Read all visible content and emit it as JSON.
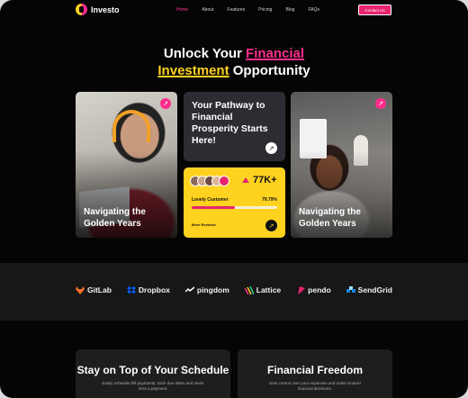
{
  "brand": {
    "name": "Investo"
  },
  "nav": {
    "items": [
      {
        "label": "Home",
        "active": true
      },
      {
        "label": "About"
      },
      {
        "label": "Features"
      },
      {
        "label": "Pricing"
      },
      {
        "label": "Blog"
      },
      {
        "label": "FAQs"
      }
    ],
    "contact_label": "Contact Us"
  },
  "hero": {
    "line1_a": "Unlock Your ",
    "line1_b": "Financial",
    "line2_a": "Investment",
    "line2_b": " Opportunity"
  },
  "cards": {
    "left_caption": "Navigating the Golden Years",
    "pathway_text": "Your Pathway to Financial Prosperity Starts Here!",
    "stat_value": "77K+",
    "customer_label": "Lovely Customer",
    "customer_pct": "79.79%",
    "customer_fraction": 0.5,
    "more_reviews": "More Reviews",
    "right_caption": "Navigating the Golden Years"
  },
  "brands": [
    {
      "name": "GitLab",
      "color": "#fc6d26"
    },
    {
      "name": "Dropbox",
      "color": "#0061ff"
    },
    {
      "name": "pingdom",
      "color": "#ffffff"
    },
    {
      "name": "Lattice",
      "color": "#ffd21f"
    },
    {
      "name": "pendo",
      "color": "#e8246f"
    },
    {
      "name": "SendGrid",
      "color": "#1a82e2"
    }
  ],
  "features": {
    "left_title": "Stay on Top of Your Schedule",
    "left_text": "Easily schedule bill payments, track due dates and never miss a payment.",
    "right_title": "Financial Freedom",
    "right_text": "Gain control over your expenses and make smarter financial decisions."
  },
  "colors": {
    "accent_pink": "#ff2e8c",
    "accent_yellow": "#ffd21f",
    "background": "#050505"
  }
}
